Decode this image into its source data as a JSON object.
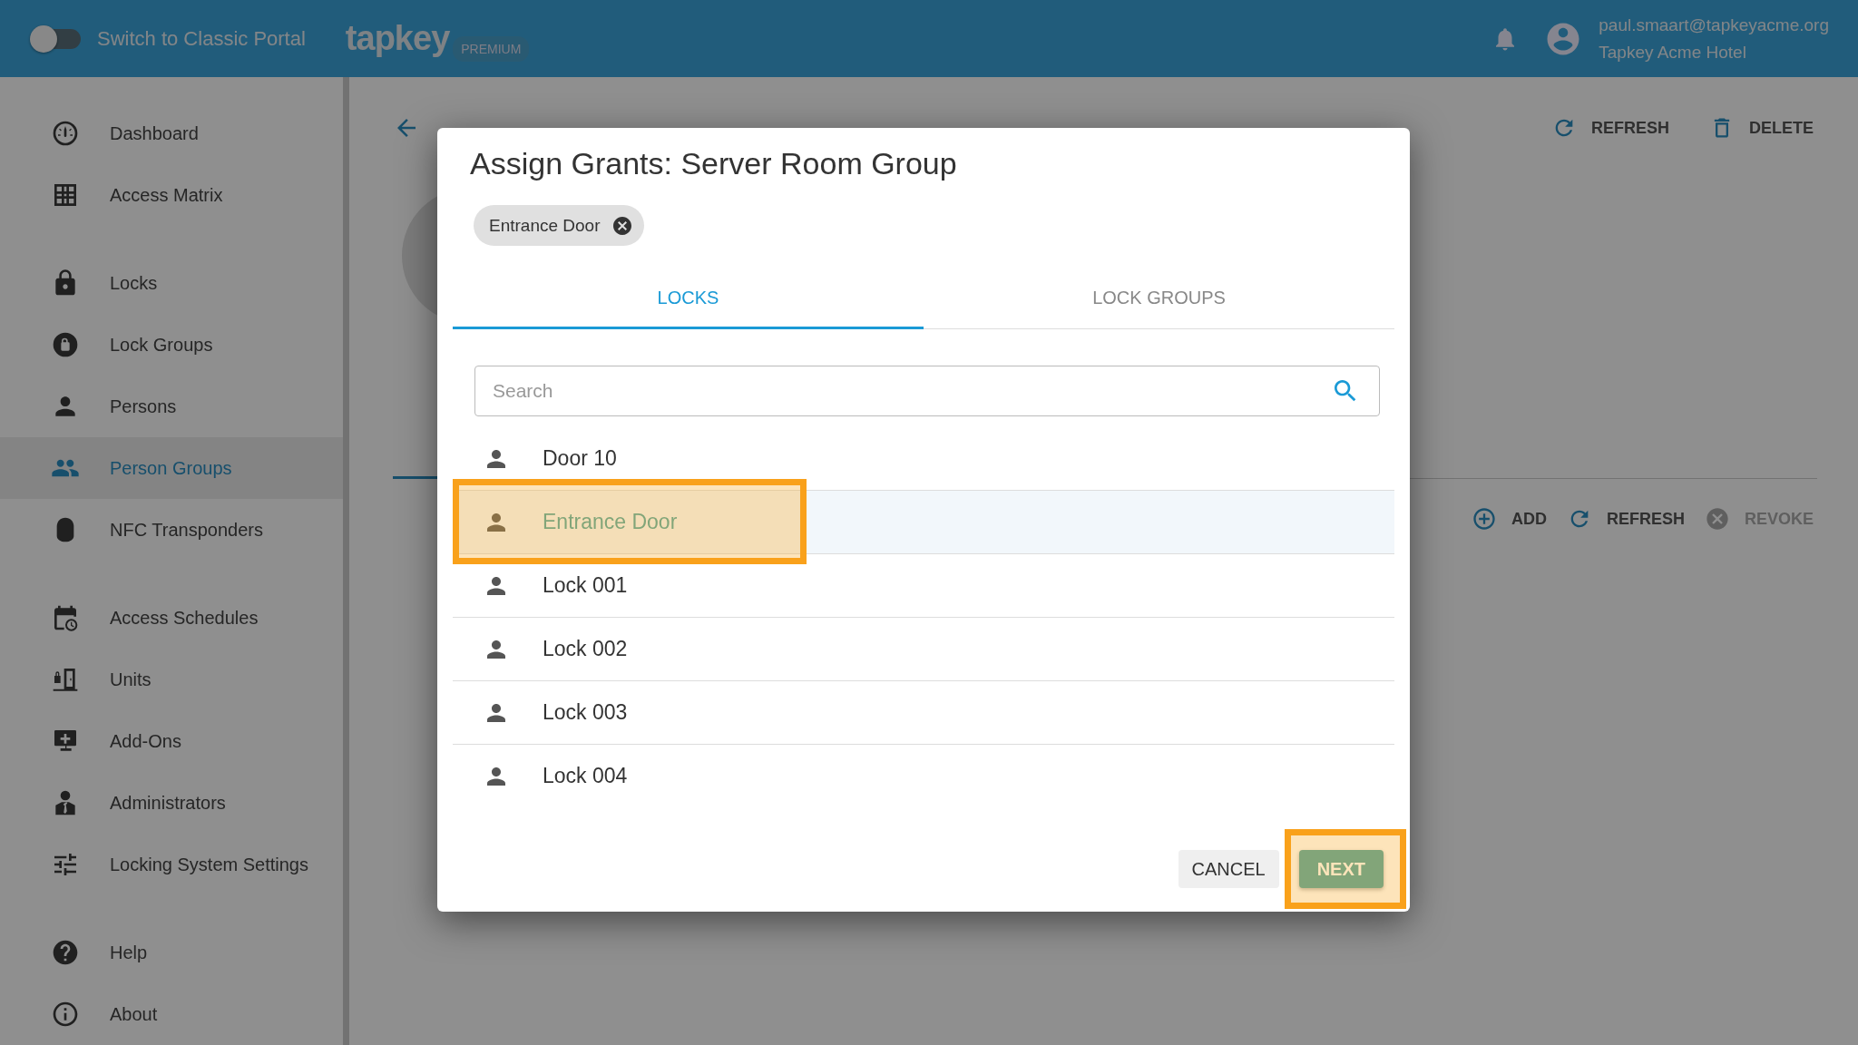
{
  "top_bar": {
    "classic_toggle": {
      "label": "Switch to Classic Portal",
      "on": false
    },
    "logo": "tapkey",
    "badge": "PREMIUM",
    "user": {
      "email": "paul.smaart@tapkeyacme.org",
      "organization": "Tapkey Acme Hotel"
    }
  },
  "sidebar": {
    "groups": [
      {
        "items": [
          {
            "label": "Dashboard",
            "selected": false
          },
          {
            "label": "Access Matrix",
            "selected": false
          }
        ]
      },
      {
        "items": [
          {
            "label": "Locks",
            "selected": false
          },
          {
            "label": "Lock Groups",
            "selected": false
          },
          {
            "label": "Persons",
            "selected": false
          },
          {
            "label": "Person Groups",
            "selected": true
          },
          {
            "label": "NFC Transponders",
            "selected": false
          }
        ]
      },
      {
        "items": [
          {
            "label": "Access Schedules",
            "selected": false
          },
          {
            "label": "Units",
            "selected": false
          },
          {
            "label": "Add-Ons",
            "selected": false
          },
          {
            "label": "Administrators",
            "selected": false
          },
          {
            "label": "Locking System Settings",
            "selected": false
          }
        ]
      },
      {
        "items": [
          {
            "label": "Help",
            "selected": false
          },
          {
            "label": "About",
            "selected": false
          }
        ]
      }
    ]
  },
  "page": {
    "toolbar": [
      {
        "label": "REFRESH",
        "kind": "refresh",
        "disabled": false
      },
      {
        "label": "DELETE",
        "kind": "delete",
        "disabled": false
      }
    ],
    "grants_toolbar": [
      {
        "label": "ADD",
        "kind": "add",
        "disabled": false
      },
      {
        "label": "REFRESH",
        "kind": "refresh",
        "disabled": false
      },
      {
        "label": "REVOKE",
        "kind": "revoke",
        "disabled": true
      }
    ]
  },
  "dialog": {
    "title": "Assign Grants: Server Room Group",
    "chips": [
      {
        "label": "Entrance Door"
      }
    ],
    "tabs": [
      {
        "label": "LOCKS",
        "selected": true
      },
      {
        "label": "LOCK GROUPS",
        "selected": false
      }
    ],
    "search": {
      "placeholder": "Search"
    },
    "items": [
      {
        "label": "Door 10",
        "selected": false,
        "highlighted": false
      },
      {
        "label": "Entrance Door",
        "selected": true,
        "highlighted": true
      },
      {
        "label": "Lock 001",
        "selected": false,
        "highlighted": false
      },
      {
        "label": "Lock 002",
        "selected": false,
        "highlighted": false
      },
      {
        "label": "Lock 003",
        "selected": false,
        "highlighted": false
      },
      {
        "label": "Lock 004",
        "selected": false,
        "highlighted": false
      }
    ],
    "buttons": [
      {
        "label": "CANCEL",
        "kind": "secondary",
        "highlighted": false
      },
      {
        "label": "NEXT",
        "kind": "primary",
        "highlighted": true
      }
    ]
  }
}
